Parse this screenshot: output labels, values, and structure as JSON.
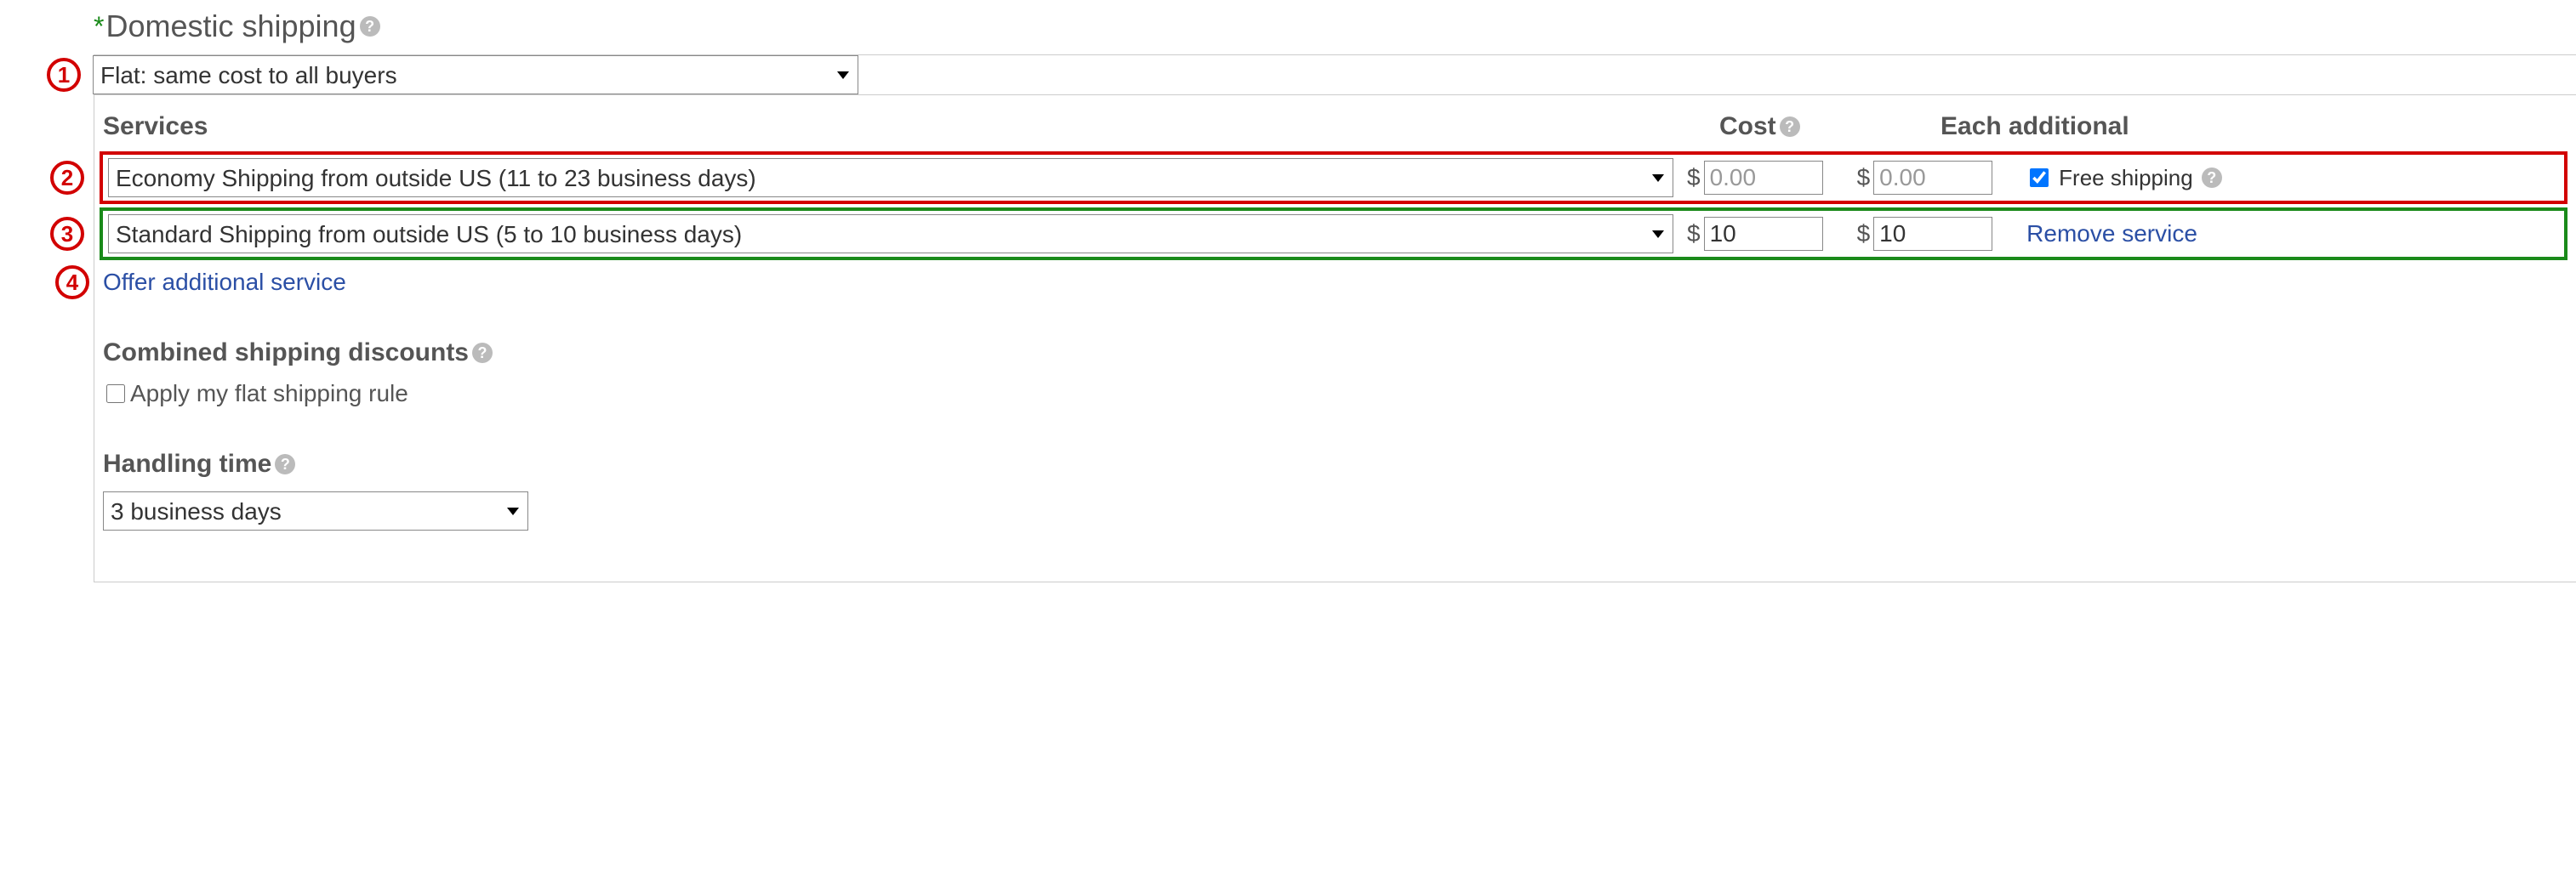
{
  "title": "Domestic shipping",
  "markers": [
    "1",
    "2",
    "3",
    "4"
  ],
  "top_select": "Flat: same cost to all buyers",
  "headers": {
    "services": "Services",
    "cost": "Cost",
    "each": "Each additional"
  },
  "rows": [
    {
      "service": "Economy Shipping from outside US (11 to 23 business days)",
      "cost": "0.00",
      "each": "0.00",
      "cost_placeholder": true,
      "each_placeholder": true,
      "free_checked": true,
      "free_label": "Free shipping"
    },
    {
      "service": "Standard Shipping from outside US (5 to 10 business days)",
      "cost": "10",
      "each": "10",
      "cost_placeholder": false,
      "each_placeholder": false,
      "remove_label": "Remove service"
    }
  ],
  "offer_link": "Offer additional service",
  "combined_title": "Combined shipping discounts",
  "apply_label": "Apply my flat shipping rule",
  "handling_title": "Handling time",
  "handling_value": "3 business days"
}
